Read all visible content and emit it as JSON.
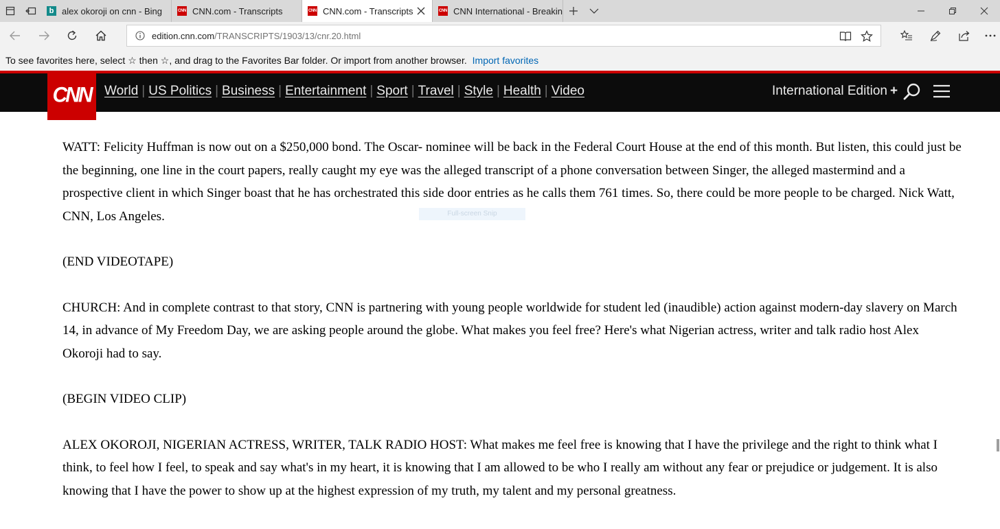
{
  "browser": {
    "tabs": [
      {
        "title": "alex okoroji on cnn - Bing",
        "favicon": "bing-icon",
        "active": false
      },
      {
        "title": "CNN.com - Transcripts",
        "favicon": "cnn-icon",
        "active": false
      },
      {
        "title": "CNN.com - Transcripts",
        "favicon": "cnn-icon",
        "active": true
      },
      {
        "title": "CNN International - Breakin",
        "favicon": "cnn-icon",
        "active": false
      }
    ],
    "favicon_text": {
      "bing": "b",
      "cnn": "CNN"
    },
    "url_domain": "edition.cnn.com",
    "url_path": "/TRANSCRIPTS/1903/13/cnr.20.html",
    "favorites_hint": "To see favorites here, select ☆ then ☆, and drag to the Favorites Bar folder. Or import from another browser.",
    "import_link": "Import favorites"
  },
  "cnn": {
    "logo": "CNN",
    "nav": [
      "World",
      "US Politics",
      "Business",
      "Entertainment",
      "Sport",
      "Travel",
      "Style",
      "Health",
      "Video"
    ],
    "separator": "|",
    "edition": "International Edition",
    "edition_plus": "+"
  },
  "transcript": [
    "WATT: Felicity Huffman is now out on a $250,000 bond. The Oscar- nominee will be back in the Federal Court House at the end of this month. But listen, this could just be the beginning, one line in the court papers, really caught my eye was the alleged transcript of a phone conversation between Singer, the alleged mastermind and a prospective client in which Singer boast that he has orchestrated this side door entries as he calls them 761 times. So, there could be more people to be charged. Nick Watt, CNN, Los Angeles.",
    "(END VIDEOTAPE)",
    "CHURCH: And in complete contrast to that story, CNN is partnering with young people worldwide for student led (inaudible) action against modern-day slavery on March 14, in advance of My Freedom Day, we are asking people around the globe. What makes you feel free? Here's what Nigerian actress, writer and talk radio host Alex Okoroji had to say.",
    "(BEGIN VIDEO CLIP)",
    "ALEX OKOROJI, NIGERIAN ACTRESS, WRITER, TALK RADIO HOST: What makes me feel free is knowing that I have the privilege and the right to think what I think, to feel how I feel, to speak and say what's in my heart, it is knowing that I am allowed to be who I really am without any fear or prejudice or judgement. It is also knowing that I have the power to show up at the highest expression of my truth, my talent and my personal greatness."
  ],
  "snip_overlay": "Full-screen Snip",
  "colors": {
    "cnn_red": "#cc0000",
    "header_black": "#0c0c0c",
    "link_blue": "#0066b4"
  }
}
